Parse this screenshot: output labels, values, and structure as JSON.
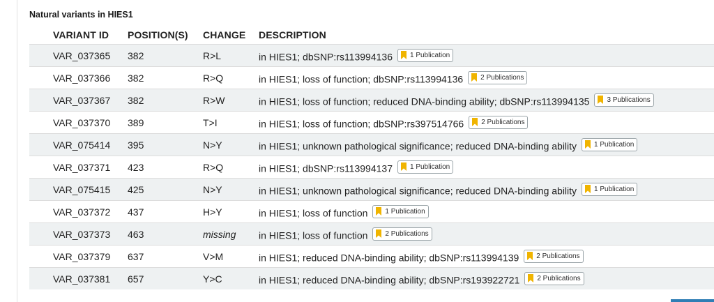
{
  "section": {
    "title": "Natural variants in HIES1"
  },
  "columns": [
    "VARIANT ID",
    "POSITION(S)",
    "CHANGE",
    "DESCRIPTION"
  ],
  "rows": [
    {
      "id": "VAR_037365",
      "position": "382",
      "change": "R>L",
      "description": "in HIES1; dbSNP:rs113994136",
      "publications": "1 Publication"
    },
    {
      "id": "VAR_037366",
      "position": "382",
      "change": "R>Q",
      "description": "in HIES1; loss of function; dbSNP:rs113994136",
      "publications": "2 Publications"
    },
    {
      "id": "VAR_037367",
      "position": "382",
      "change": "R>W",
      "description": "in HIES1; loss of function; reduced DNA-binding ability; dbSNP:rs113994135",
      "publications": "3 Publications"
    },
    {
      "id": "VAR_037370",
      "position": "389",
      "change": "T>I",
      "description": "in HIES1; loss of function; dbSNP:rs397514766",
      "publications": "2 Publications"
    },
    {
      "id": "VAR_075414",
      "position": "395",
      "change": "N>Y",
      "description": "in HIES1; unknown pathological significance; reduced DNA-binding ability",
      "publications": "1 Publication"
    },
    {
      "id": "VAR_037371",
      "position": "423",
      "change": "R>Q",
      "description": "in HIES1; dbSNP:rs113994137",
      "publications": "1 Publication"
    },
    {
      "id": "VAR_075415",
      "position": "425",
      "change": "N>Y",
      "description": "in HIES1; unknown pathological significance; reduced DNA-binding ability",
      "publications": "1 Publication"
    },
    {
      "id": "VAR_037372",
      "position": "437",
      "change": "H>Y",
      "description": "in HIES1; loss of function",
      "publications": "1 Publication"
    },
    {
      "id": "VAR_037373",
      "position": "463",
      "change": "missing",
      "description": "in HIES1; loss of function",
      "publications": "2 Publications"
    },
    {
      "id": "VAR_037379",
      "position": "637",
      "change": "V>M",
      "description": "in HIES1; reduced DNA-binding ability; dbSNP:rs113994139",
      "publications": "2 Publications"
    },
    {
      "id": "VAR_037381",
      "position": "657",
      "change": "Y>C",
      "description": "in HIES1; reduced DNA-binding ability; dbSNP:rs193922721",
      "publications": "2 Publications"
    }
  ],
  "colors": {
    "stripe": "#eef1f2",
    "bookmark": "#f0b400",
    "badge_border": "#9aa4a8",
    "accent_bar": "#2f7eb5"
  },
  "icons": {
    "publication": "bookmark-icon"
  }
}
